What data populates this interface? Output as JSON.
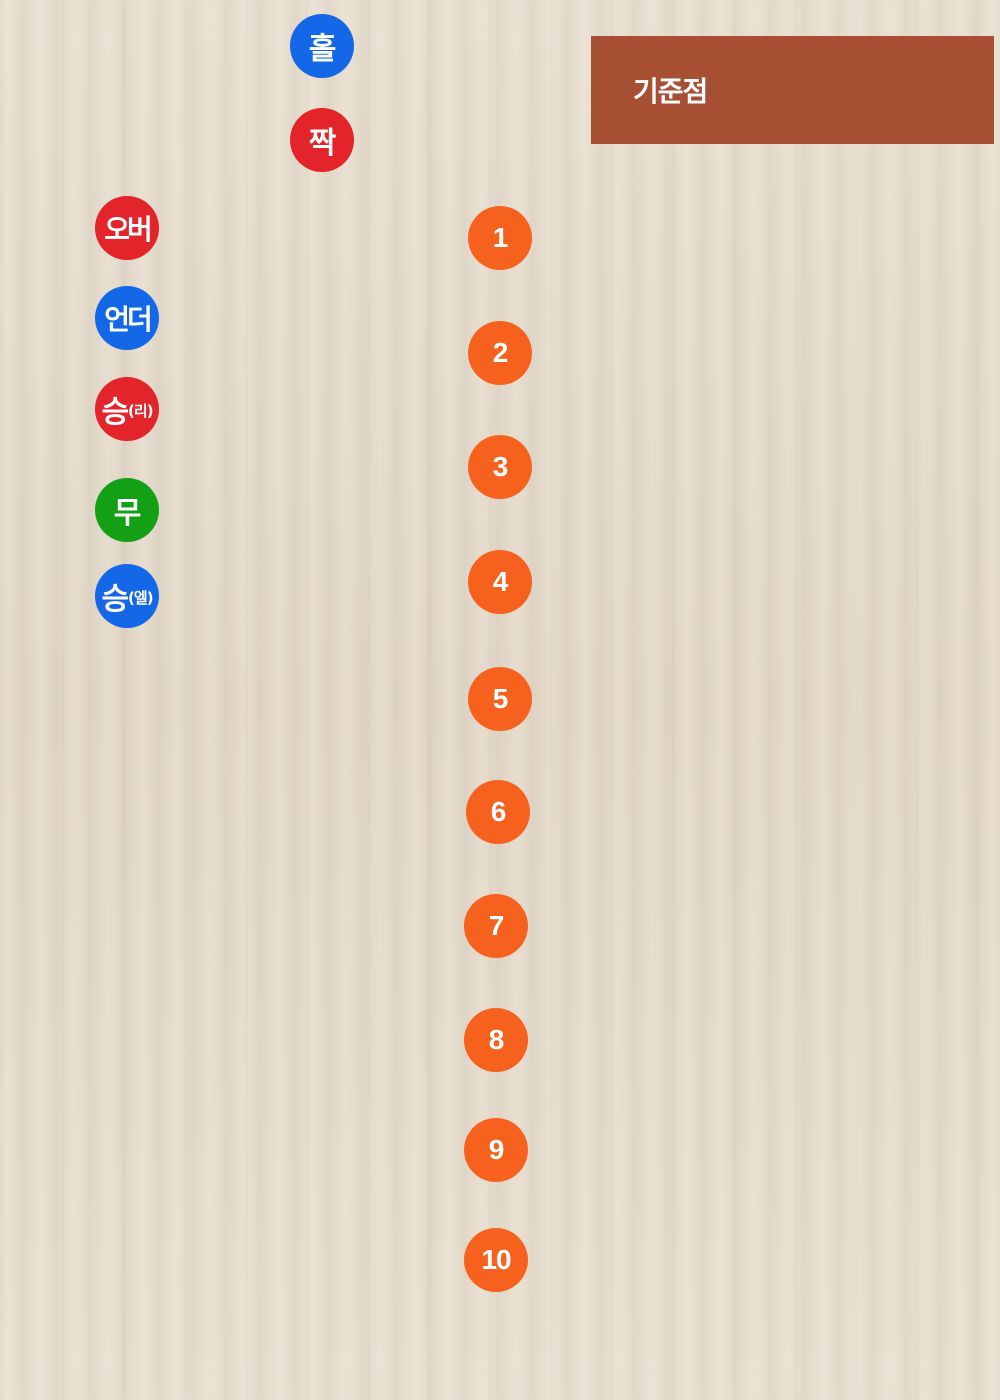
{
  "header": {
    "title": "기준점",
    "background_color": "#a64f33"
  },
  "colors": {
    "blue": "#1467e6",
    "red": "#e3242b",
    "green": "#14a014",
    "orange": "#f6621d",
    "wood_background": "#e6dccd"
  },
  "odd_even": {
    "odd_label": "홀",
    "even_label": "짝"
  },
  "bet_options": {
    "over_label": "오버",
    "under_label": "언더",
    "win_left_main": "승",
    "win_left_sub": "(리)",
    "draw_label": "무",
    "win_right_main": "승",
    "win_right_sub": "(엘)"
  },
  "numbers": [
    "1",
    "2",
    "3",
    "4",
    "5",
    "6",
    "7",
    "8",
    "9",
    "10"
  ]
}
